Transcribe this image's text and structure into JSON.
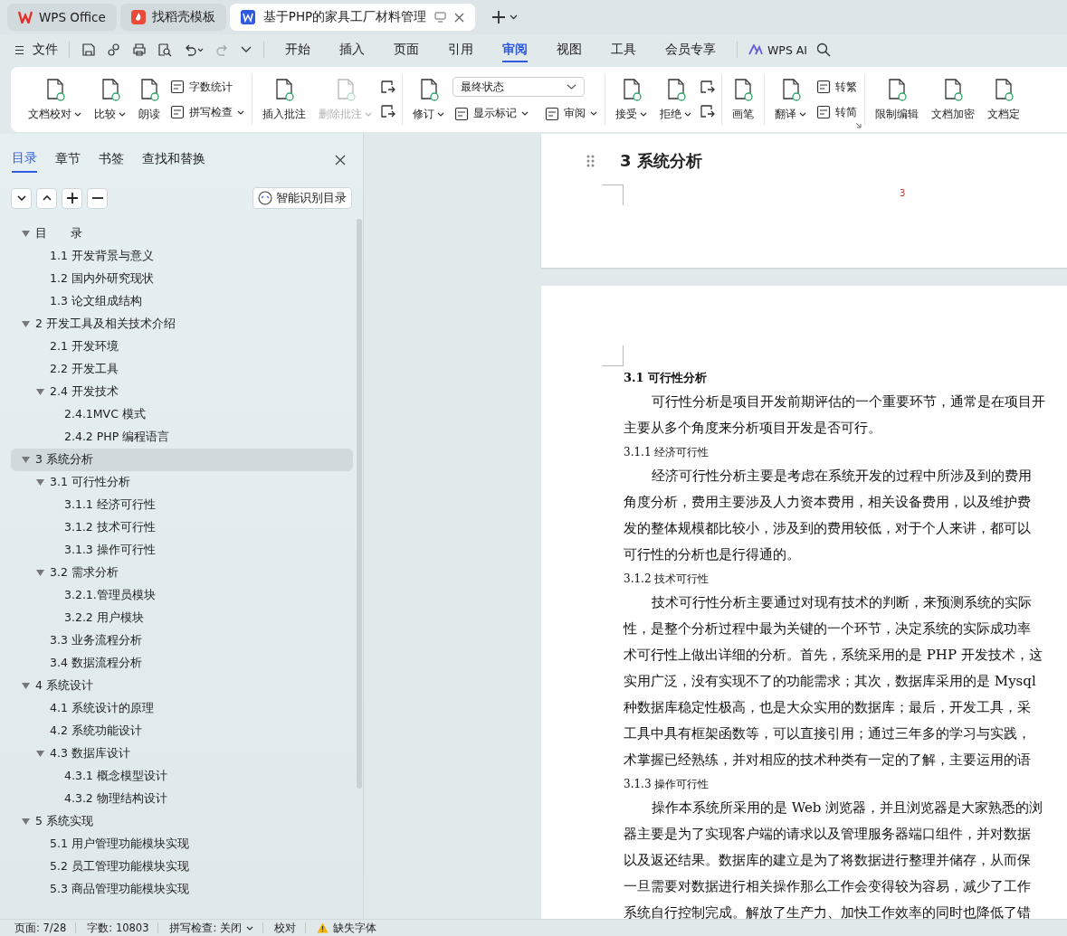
{
  "tabs": [
    {
      "label": "WPS Office",
      "kind": "home",
      "selected": false
    },
    {
      "label": "找稻壳模板",
      "kind": "template",
      "selected": false
    },
    {
      "label": "基于PHP的家具工厂材料管理",
      "kind": "doc",
      "selected": true
    }
  ],
  "menu": {
    "file": "文件",
    "quick_access": [
      {
        "kind": "save",
        "disabled": false
      },
      {
        "kind": "link",
        "disabled": false
      },
      {
        "kind": "print",
        "disabled": false
      },
      {
        "kind": "preview",
        "disabled": false
      },
      {
        "kind": "undo",
        "disabled": false
      },
      {
        "kind": "redo",
        "disabled": true
      },
      {
        "kind": "more",
        "disabled": false
      }
    ],
    "tabs": [
      {
        "label": "开始",
        "selected": false
      },
      {
        "label": "插入",
        "selected": false
      },
      {
        "label": "页面",
        "selected": false
      },
      {
        "label": "引用",
        "selected": false
      },
      {
        "label": "审阅",
        "selected": true
      },
      {
        "label": "视图",
        "selected": false
      },
      {
        "label": "工具",
        "selected": false
      },
      {
        "label": "会员专享",
        "selected": false
      }
    ],
    "ai": "WPS AI"
  },
  "ribbon": [
    {
      "columns": [
        {
          "kind": "large",
          "label": "文档校对",
          "dropdown": true,
          "disabled": false
        },
        {
          "kind": "large",
          "label": "比较",
          "dropdown": true,
          "disabled": false
        },
        {
          "kind": "large",
          "label": "朗读",
          "dropdown": false,
          "disabled": false
        },
        {
          "kind": "stack",
          "items": [
            {
              "label": "字数统计",
              "dropdown": false
            },
            {
              "label": "拼写检查",
              "dropdown": true
            }
          ]
        }
      ]
    },
    {
      "columns": [
        {
          "kind": "large",
          "label": "插入批注",
          "dropdown": false,
          "disabled": false
        },
        {
          "kind": "large",
          "label": "删除批注",
          "dropdown": true,
          "disabled": true
        },
        {
          "kind": "icon_stack",
          "items": [
            {
              "disabled": false
            },
            {
              "disabled": false
            }
          ]
        }
      ]
    },
    {
      "columns": [
        {
          "kind": "large",
          "label": "修订",
          "dropdown": true,
          "disabled": false
        },
        {
          "kind": "select_stack",
          "value": "最终状态",
          "items": [
            {
              "label": "显示标记",
              "dropdown": true
            },
            {
              "label": "审阅",
              "dropdown": true
            }
          ]
        }
      ]
    },
    {
      "columns": [
        {
          "kind": "large",
          "label": "接受",
          "dropdown": true,
          "disabled": false
        },
        {
          "kind": "large",
          "label": "拒绝",
          "dropdown": true,
          "disabled": false
        },
        {
          "kind": "icon_stack",
          "items": [
            {
              "disabled": false
            },
            {
              "disabled": false
            }
          ]
        }
      ]
    },
    {
      "columns": [
        {
          "kind": "large",
          "label": "画笔",
          "dropdown": false,
          "disabled": false
        }
      ]
    },
    {
      "launcher": true,
      "columns": [
        {
          "kind": "large",
          "label": "翻译",
          "dropdown": true,
          "disabled": false
        },
        {
          "kind": "stack",
          "items": [
            {
              "label": "转繁",
              "dropdown": false
            },
            {
              "label": "转简",
              "dropdown": false
            }
          ]
        }
      ]
    },
    {
      "columns": [
        {
          "kind": "large",
          "label": "限制编辑",
          "dropdown": false,
          "disabled": false
        },
        {
          "kind": "large",
          "label": "文档加密",
          "dropdown": false,
          "disabled": false
        },
        {
          "kind": "large",
          "label": "文档定",
          "dropdown": false,
          "disabled": false
        }
      ]
    }
  ],
  "sidebar": {
    "tabs": [
      {
        "label": "目录",
        "selected": true
      },
      {
        "label": "章节",
        "selected": false
      },
      {
        "label": "书签",
        "selected": false
      },
      {
        "label": "查找和替换",
        "selected": false
      }
    ],
    "smart_button": "智能识别目录",
    "outline": [
      {
        "label": "目　　录",
        "expanded": true,
        "selected": false,
        "children": [
          {
            "label": "1.1 开发背景与意义",
            "selected": false
          },
          {
            "label": "1.2 国内外研究现状",
            "selected": false
          },
          {
            "label": "1.3 论文组成结构",
            "selected": false
          }
        ]
      },
      {
        "label": "2 开发工具及相关技术介绍",
        "expanded": true,
        "selected": false,
        "children": [
          {
            "label": "2.1 开发环境",
            "selected": false
          },
          {
            "label": "2.2 开发工具",
            "selected": false
          },
          {
            "label": "2.4 开发技术",
            "expanded": true,
            "selected": false,
            "children": [
              {
                "label": "2.4.1MVC 模式",
                "selected": false
              },
              {
                "label": "2.4.2 PHP 编程语言",
                "selected": false
              }
            ]
          }
        ]
      },
      {
        "label": "3 系统分析",
        "expanded": true,
        "selected": true,
        "children": [
          {
            "label": "3.1 可行性分析",
            "expanded": true,
            "selected": false,
            "children": [
              {
                "label": "3.1.1 经济可行性",
                "selected": false
              },
              {
                "label": "3.1.2 技术可行性",
                "selected": false
              },
              {
                "label": "3.1.3 操作可行性",
                "selected": false
              }
            ]
          },
          {
            "label": "3.2 需求分析",
            "expanded": true,
            "selected": false,
            "children": [
              {
                "label": "3.2.1.管理员模块",
                "selected": false
              },
              {
                "label": "3.2.2 用户模块",
                "selected": false
              }
            ]
          },
          {
            "label": "3.3 业务流程分析",
            "selected": false
          },
          {
            "label": "3.4 数据流程分析",
            "selected": false
          }
        ]
      },
      {
        "label": "4 系统设计",
        "expanded": true,
        "selected": false,
        "children": [
          {
            "label": "4.1 系统设计的原理",
            "selected": false
          },
          {
            "label": "4.2 系统功能设计",
            "selected": false
          },
          {
            "label": "4.3 数据库设计",
            "expanded": true,
            "selected": false,
            "children": [
              {
                "label": "4.3.1 概念模型设计",
                "selected": false
              },
              {
                "label": "4.3.2 物理结构设计",
                "selected": false
              }
            ]
          }
        ]
      },
      {
        "label": "5 系统实现",
        "expanded": true,
        "selected": false,
        "children": [
          {
            "label": "5.1 用户管理功能模块实现",
            "selected": false
          },
          {
            "label": "5.2 员工管理功能模块实现",
            "selected": false
          },
          {
            "label": "5.3 商品管理功能模块实现",
            "selected": false
          }
        ]
      }
    ]
  },
  "document": {
    "previous_page": {
      "heading": "3 系统分析",
      "page_number": "3"
    },
    "blocks": [
      {
        "kind": "heading",
        "text": "3.1 可行性分析"
      },
      {
        "kind": "paragraph",
        "lines": [
          "可行性分析是项目开发前期评估的一个重要环节，通常是在项目开",
          "主要从多个角度来分析项目开发是否可行。"
        ]
      },
      {
        "kind": "subheading",
        "text": "3.1.1 经济可行性"
      },
      {
        "kind": "paragraph",
        "lines": [
          "经济可行性分析主要是考虑在系统开发的过程中所涉及到的费用",
          "角度分析，费用主要涉及人力资本费用，相关设备费用，以及维护费",
          "发的整体规模都比较小，涉及到的费用较低，对于个人来讲，都可以",
          "可行性的分析也是行得通的。"
        ]
      },
      {
        "kind": "subheading",
        "text": "3.1.2 技术可行性"
      },
      {
        "kind": "paragraph",
        "lines": [
          "技术可行性分析主要通过对现有技术的判断，来预测系统的实际",
          "性，是整个分析过程中最为关键的一个环节，决定系统的实际成功率",
          "术可行性上做出详细的分析。首先，系统采用的是 PHP 开发技术，这",
          "实用广泛，没有实现不了的功能需求；其次，数据库采用的是 Mysql",
          "种数据库稳定性极高，也是大众实用的数据库；最后，开发工具，采",
          "工具中具有框架函数等，可以直接引用；通过三年多的学习与实践，",
          "术掌握已经熟练，并对相应的技术种类有一定的了解，主要运用的语"
        ]
      },
      {
        "kind": "subheading",
        "text": "3.1.3 操作可行性"
      },
      {
        "kind": "paragraph",
        "lines": [
          "操作本系统所采用的是 Web 浏览器，并且浏览器是大家熟悉的浏",
          "器主要是为了实现客户端的请求以及管理服务器端口组件，并对数据",
          "以及返还结果。数据库的建立是为了将数据进行整理并储存，从而保",
          "一旦需要对数据进行相关操作那么工作会变得较为容易，减少了工作",
          "系统自行控制完成。解放了生产力、加快工作效率的同时也降低了错"
        ]
      }
    ]
  },
  "status_bar": [
    {
      "kind": "text",
      "label": "页面: 7/28"
    },
    {
      "kind": "text",
      "label": "字数: 10803"
    },
    {
      "kind": "dropdown",
      "label": "拼写检查: 关闭"
    },
    {
      "kind": "text",
      "label": "校对"
    },
    {
      "kind": "warning",
      "label": "缺失字体"
    }
  ]
}
